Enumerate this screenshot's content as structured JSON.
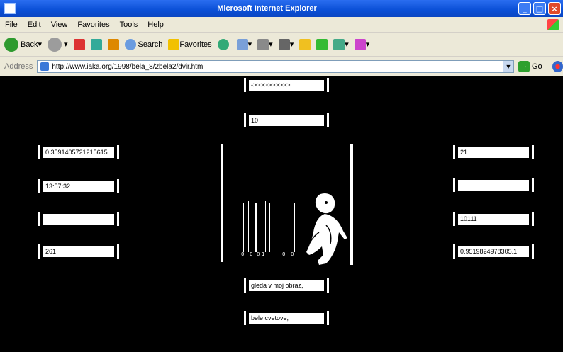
{
  "window": {
    "title": "Microsoft Internet Explorer"
  },
  "menu": [
    "File",
    "Edit",
    "View",
    "Favorites",
    "Tools",
    "Help"
  ],
  "toolbar": {
    "back": "Back",
    "search": "Search",
    "favorites": "Favorites"
  },
  "address": {
    "label": "Address",
    "url": "http://www.iaka.org/1998/bela_8/2bela2/dvir.htm",
    "go": "Go"
  },
  "fields": {
    "top1": "->>>>>>>>>>",
    "top2": "10",
    "left1": "0.3591405721215615",
    "left2": "13:57:32",
    "left3": "",
    "left4": "261",
    "right1": "21",
    "right2": "",
    "right3": "10111",
    "right4": "0.9519824978305.1",
    "bottom1": "gleda v moj obraz,",
    "bottom2": "bele cvetove,"
  },
  "digits": [
    "0",
    "0",
    "0",
    "1",
    "0",
    "0"
  ],
  "colors": {
    "background": "#000000",
    "titlebar": "#0a4fd6",
    "chrome": "#ece9d8"
  }
}
